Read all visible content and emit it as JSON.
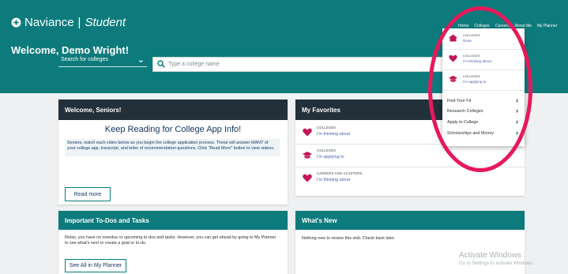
{
  "header": {
    "brand": "Naviance",
    "separator": "|",
    "product": "Student",
    "welcome": "Welcome, Demo Wright!",
    "search_select": "Search for colleges",
    "search_placeholder": "Type a college name",
    "brand_color": "#0d7b7c"
  },
  "nav": [
    "Home",
    "Colleges",
    "Careers",
    "About Me",
    "My Planner"
  ],
  "dropdown": {
    "items": [
      {
        "icon": "house-icon",
        "type": "COLLEGES",
        "status": "None"
      },
      {
        "icon": "heart-icon",
        "type": "COLLEGES",
        "status": "I'm thinking about"
      },
      {
        "icon": "graduation-cap-icon",
        "type": "COLLEGES",
        "status": "I'm applying to"
      }
    ],
    "links": [
      "Find Your Fit",
      "Research Colleges",
      "Apply to College",
      "Scholarships and Money"
    ]
  },
  "seniors": {
    "title": "Welcome, Seniors!",
    "heading": "Keep Reading for College App Info!",
    "body": "Seniors, watch each video below as you begin the college application process. These will answer MANY of your college app, transcript, and letter of recommendation questions. Click \"Read More\" button to view videos.",
    "button": "Read more"
  },
  "favorites": {
    "title": "My Favorites",
    "items": [
      {
        "icon": "heart-icon",
        "type": "COLLEGES",
        "status": "I'm thinking about"
      },
      {
        "icon": "graduation-cap-icon",
        "type": "COLLEGES",
        "status": "I'm applying to"
      },
      {
        "icon": "heart-icon",
        "type": "CAREERS AND CLUSTERS",
        "status": "I'm thinking about"
      }
    ]
  },
  "todo": {
    "title": "Important To-Dos and Tasks",
    "body": "Relax, you have no overdue or upcoming to-dos and tasks. However, you can get ahead by going to My Planner to see what's next or create a goal or to-do.",
    "button": "See All in My Planner"
  },
  "whats_new": {
    "title": "What's New",
    "body": "Nothing new to review this visit. Check back later."
  },
  "watermark": {
    "line1": "Activate Windows",
    "line2": "Go to Settings to activate Windows."
  },
  "colors": {
    "accent": "#e6195a",
    "dark": "#23303a",
    "link": "#4a66a8"
  }
}
